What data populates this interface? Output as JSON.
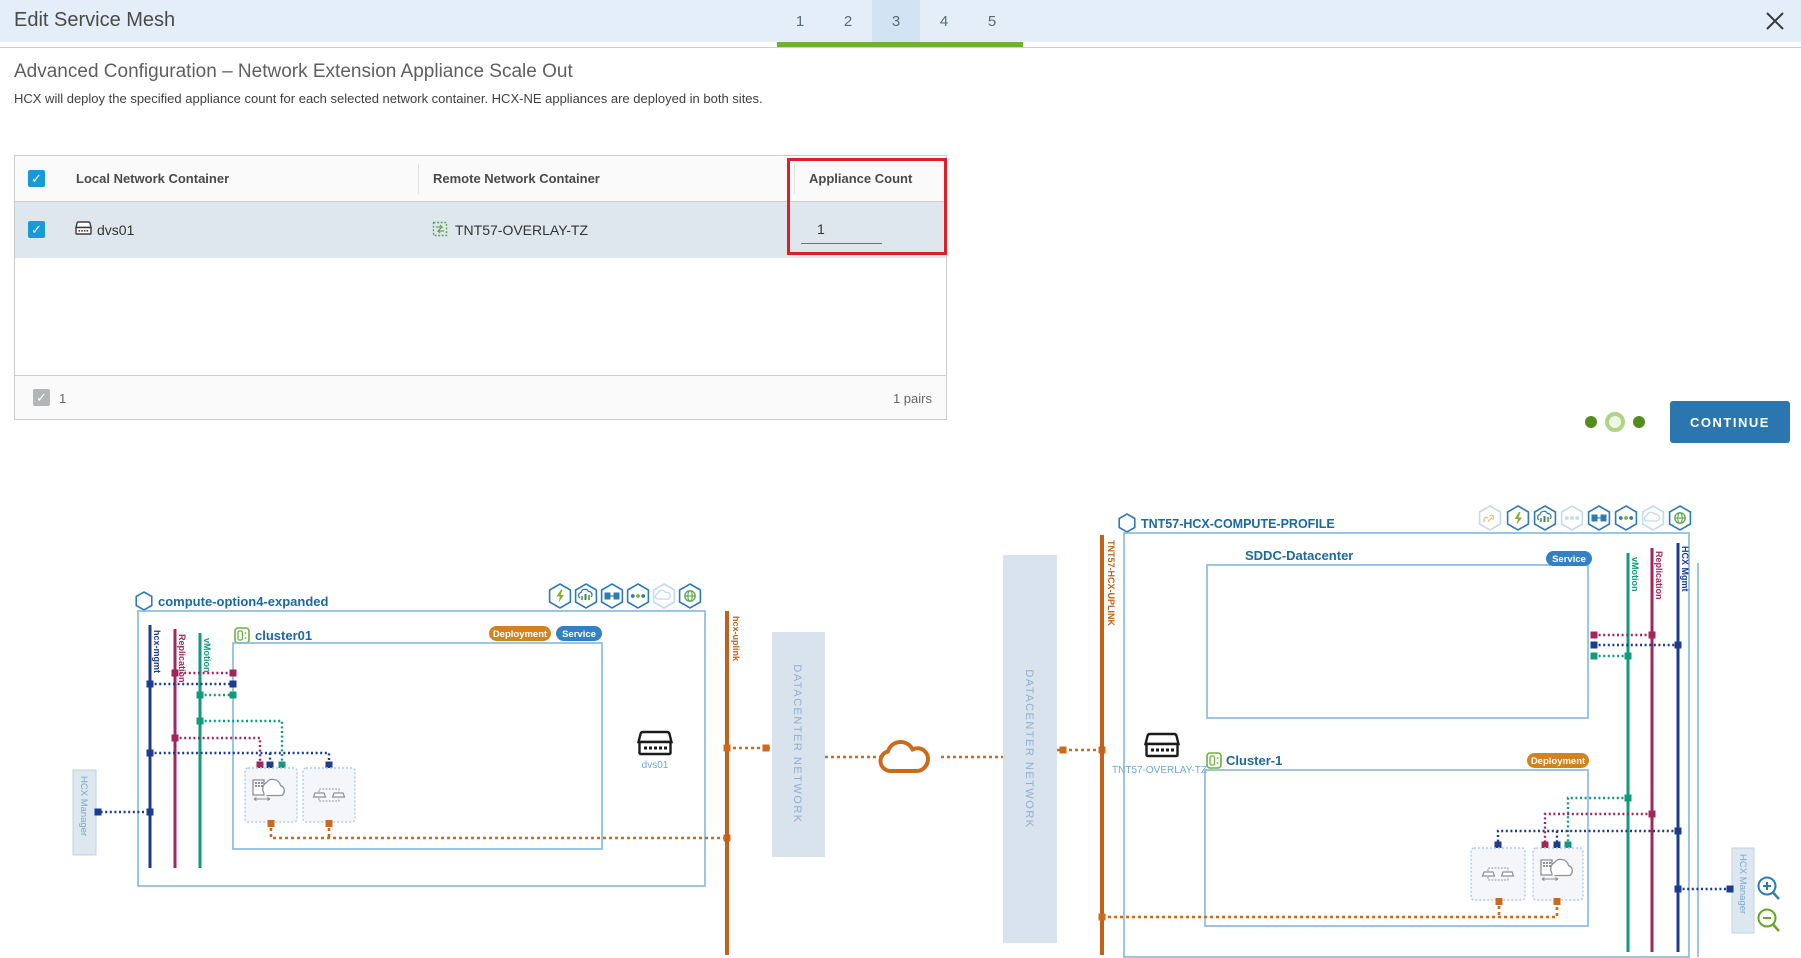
{
  "header": {
    "title": "Edit Service Mesh",
    "steps": [
      "1",
      "2",
      "3",
      "4",
      "5"
    ],
    "active_step": "3"
  },
  "content": {
    "heading": "Advanced Configuration – Network Extension Appliance Scale Out",
    "description": "HCX will deploy the specified appliance count for each selected network container. HCX-NE appliances are deployed in both sites."
  },
  "table": {
    "columns": [
      "Local Network Container",
      "Remote Network Container",
      "Appliance Count"
    ],
    "row": {
      "local": "dvs01",
      "remote": "TNT57-OVERLAY-TZ",
      "appliance_count": "1"
    },
    "footer": {
      "selected_count": "1",
      "pairs": "1 pairs"
    }
  },
  "actions": {
    "continue_label": "CONTINUE"
  },
  "diagram": {
    "left_profile": {
      "name": "compute-option4-expanded",
      "cluster": "cluster01",
      "badge_deployment": "Deployment",
      "badge_service": "Service",
      "rail_mgmt": "hcx-mgmt",
      "rail_replication": "Replication",
      "rail_vmotion": "vMotion",
      "uplink": "hcx-uplink",
      "switch": "dvs01",
      "manager": "HCX Manager"
    },
    "network": {
      "left_bar": "DATACENTER NETWORK",
      "right_bar": "DATACENTER NETWORK"
    },
    "right_profile": {
      "name": "TNT57-HCX-COMPUTE-PROFILE",
      "datacenter": "SDDC-Datacenter",
      "cluster": "Cluster-1",
      "badge_service": "Service",
      "badge_deployment": "Deployment",
      "rail_vmotion": "vMotion",
      "rail_replication": "Replication",
      "rail_mgmt": "HCX Mgmt",
      "uplink": "TNT57-HCX-UPLINK",
      "switch": "TNT57-OVERLAY-TZ",
      "manager": "HCX Manager"
    }
  }
}
